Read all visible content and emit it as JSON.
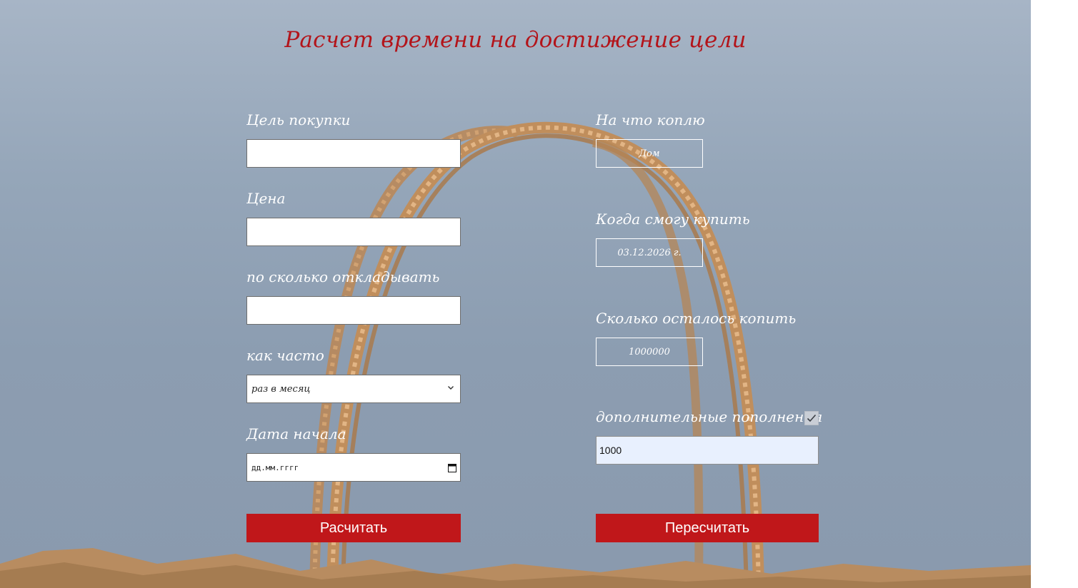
{
  "title": "Расчет времени на достижение цели",
  "form": {
    "goal_label": "Цель покупки",
    "goal_value": "",
    "price_label": "Цена",
    "price_value": "",
    "amount_label": "по сколько откладывать",
    "amount_value": "",
    "frequency_label": "как часто",
    "frequency_selected": "раз в месяц",
    "start_date_label": "Дата начала",
    "start_date_placeholder": "дд.мм.гггг",
    "calculate_button": "Расчитать"
  },
  "result": {
    "saving_for_label": "На что коплю",
    "saving_for_value": "Дом",
    "when_label": "Когда смогу купить",
    "when_value": "03.12.2026 г.",
    "remaining_label": "Сколько осталось копить",
    "remaining_value": "1000000",
    "extra_label": "дополнительные пополнения",
    "extra_checked": true,
    "extra_value": "1000",
    "recalculate_button": "Пересчитать"
  },
  "colors": {
    "accent": "#c0171a",
    "title": "#b3141a",
    "background": "#95a6b9"
  }
}
